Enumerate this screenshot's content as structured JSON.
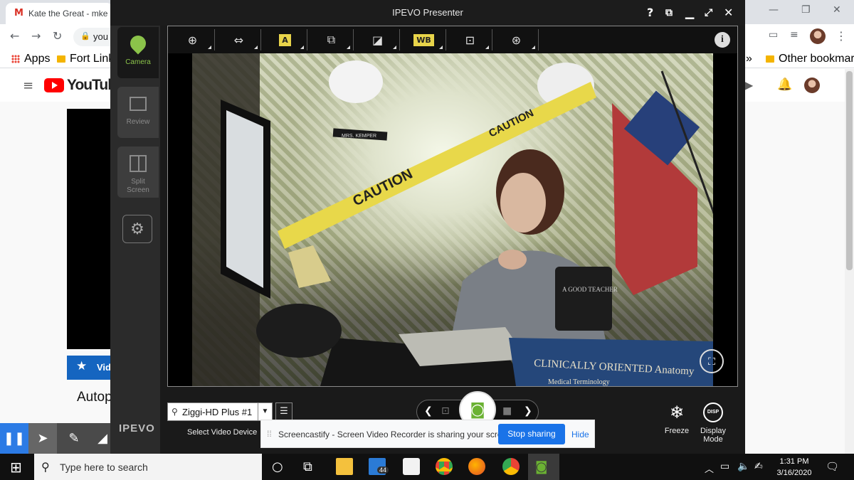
{
  "browser": {
    "tab_title": "Kate the Great - mke",
    "omnibox_text": "you",
    "bookmarks": [
      {
        "label": "Apps"
      },
      {
        "label": "Fort Links"
      },
      {
        "label": "Other bookmarks"
      }
    ],
    "overflow_chevron": "»"
  },
  "youtube": {
    "logo_text": "YouTube",
    "blue_bar_text": "Vid",
    "video_title": "Autop"
  },
  "ipevo": {
    "title": "IPEVO Presenter",
    "titlebar_help": "?",
    "sidebar": [
      {
        "label": "Camera",
        "icon": "camera-pin-icon"
      },
      {
        "label": "Review",
        "icon": "image-icon"
      },
      {
        "label": "Split Screen",
        "icon": "split-screen-icon"
      }
    ],
    "logo": "IPEVO",
    "tools": [
      {
        "name": "zoom-tool",
        "glyph": "⊕"
      },
      {
        "name": "rotate-flip-tool",
        "glyph": "⇔"
      },
      {
        "name": "auto-focus-tool",
        "glyph": "A"
      },
      {
        "name": "resolution-tool",
        "glyph": "⧉"
      },
      {
        "name": "exposure-tool",
        "glyph": "◪"
      },
      {
        "name": "white-balance-tool",
        "glyph": "WB"
      },
      {
        "name": "focus-area-tool",
        "glyph": "⊡"
      },
      {
        "name": "color-effects-tool",
        "glyph": "⊛"
      }
    ],
    "info_glyph": "i",
    "device_name": "Ziggi-HD Plus #1",
    "select_device_label": "Select Video Device",
    "freeze_label": "Freeze",
    "display_mode_label": "Display Mode",
    "display_mode_badge": "DISP",
    "camera_scene": {
      "tape_text": "CAUTION",
      "nameplate": "MRS. KEMPER",
      "book_text": "CLINICALLY ORIENTED Anatomy",
      "book2_text": "Medical Terminology",
      "mug_text": "A GOOD TEACHER"
    }
  },
  "share_notice": {
    "message": "Screencastify - Screen Video Recorder is sharing your screen.",
    "stop_label": "Stop sharing",
    "hide_label": "Hide"
  },
  "taskbar": {
    "search_placeholder": "Type here to search",
    "mail_badge": "44",
    "time": "1:31 PM",
    "date": "3/16/2020"
  }
}
